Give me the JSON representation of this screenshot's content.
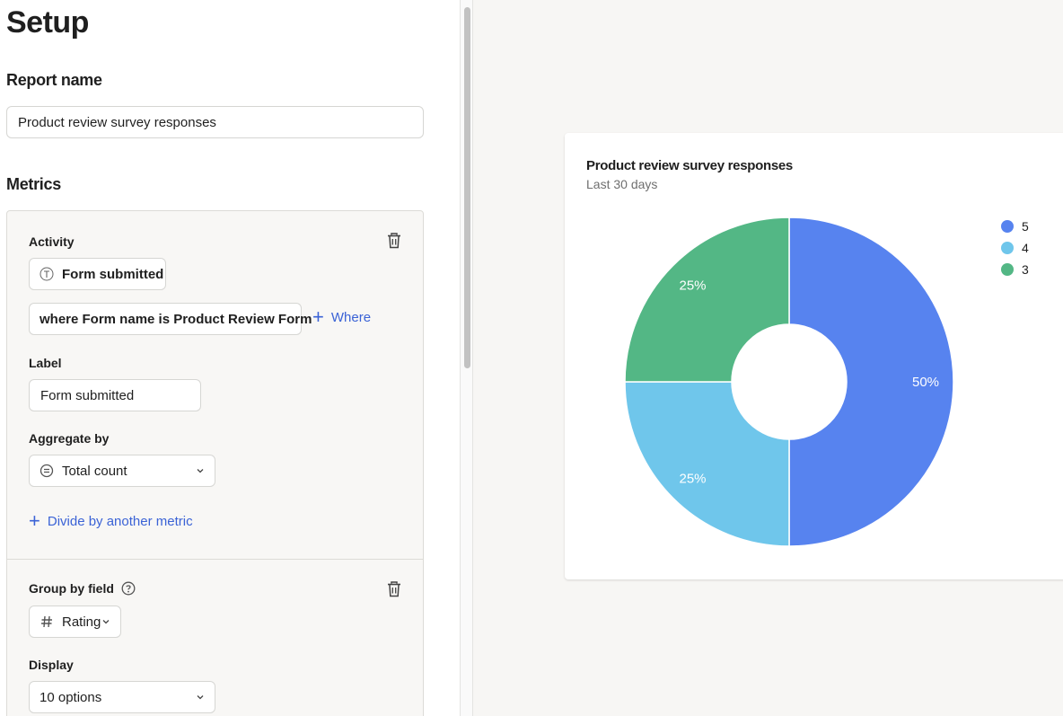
{
  "setup": {
    "title": "Setup",
    "report_name_label": "Report name",
    "report_name_value": "Product review survey responses",
    "metrics_label": "Metrics"
  },
  "metric": {
    "activity_label": "Activity",
    "activity_value": "Form submitted",
    "filter_value": "where Form name is Product Review Form",
    "where_label": "Where",
    "label_label": "Label",
    "label_value": "Form submitted",
    "aggregate_label": "Aggregate by",
    "aggregate_value": "Total count",
    "divide_label": "Divide by another metric"
  },
  "group": {
    "group_label": "Group by field",
    "group_value": "Rating",
    "display_label": "Display",
    "display_value": "10 options"
  },
  "icons": {
    "activity": "text-type-icon",
    "aggregate": "equals-circle-icon",
    "group": "hash-icon",
    "delete": "trash-icon",
    "help": "question-circle-icon",
    "dropdown": "chevron-down-icon"
  },
  "colors": {
    "accent": "#3b63d6",
    "slice_5": "#5783ef",
    "slice_4": "#6fc6eb",
    "slice_3": "#53b785"
  },
  "chart_data": {
    "type": "pie",
    "title": "Product review survey responses",
    "subtitle": "Last 30 days",
    "donut": true,
    "legend_position": "top-right",
    "series": [
      {
        "name": "5",
        "value": 50,
        "label": "50%",
        "color": "#5783ef"
      },
      {
        "name": "4",
        "value": 25,
        "label": "25%",
        "color": "#6fc6eb"
      },
      {
        "name": "3",
        "value": 25,
        "label": "25%",
        "color": "#53b785"
      }
    ]
  }
}
